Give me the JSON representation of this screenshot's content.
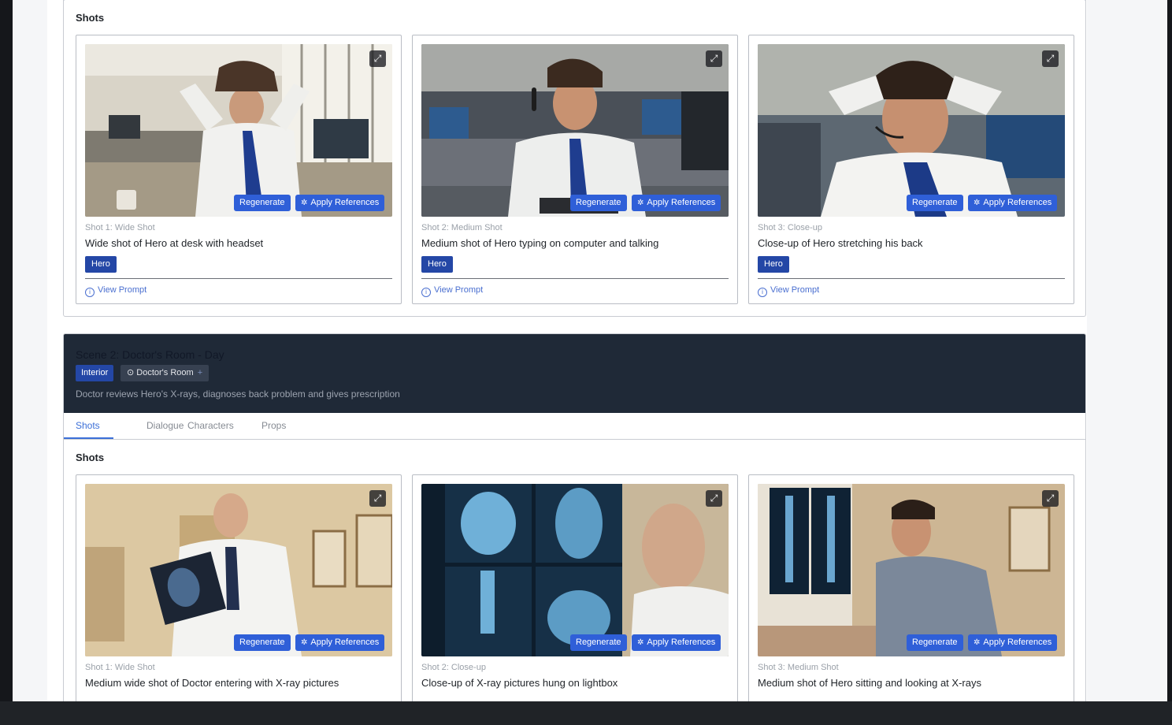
{
  "scene1": {
    "section_title": "Shots",
    "shots": [
      {
        "label": "Shot 1: Wide Shot",
        "description": "Wide shot of Hero at desk with headset",
        "character": "Hero",
        "regenerate": "Regenerate",
        "apply_references": "Apply References",
        "view_prompt": "View Prompt"
      },
      {
        "label": "Shot 2: Medium Shot",
        "description": "Medium shot of Hero typing on computer and talking",
        "character": "Hero",
        "regenerate": "Regenerate",
        "apply_references": "Apply References",
        "view_prompt": "View Prompt"
      },
      {
        "label": "Shot 3: Close-up",
        "description": "Close-up of Hero stretching his back",
        "character": "Hero",
        "regenerate": "Regenerate",
        "apply_references": "Apply References",
        "view_prompt": "View Prompt"
      }
    ]
  },
  "scene2": {
    "title": "Scene 2: Doctor's Room - Day",
    "setting_tag": "Interior",
    "location_tag": "Doctor's Room",
    "description": "Doctor reviews Hero's X-rays, diagnoses back problem and gives prescription",
    "tabs": [
      "Shots",
      "Dialogue",
      "Characters",
      "Props"
    ],
    "active_tab": "Shots",
    "section_title": "Shots",
    "shots": [
      {
        "label": "Shot 1: Wide Shot",
        "description": "Medium wide shot of Doctor entering with X-ray pictures",
        "regenerate": "Regenerate",
        "apply_references": "Apply References"
      },
      {
        "label": "Shot 2: Close-up",
        "description": "Close-up of X-ray pictures hung on lightbox",
        "regenerate": "Regenerate",
        "apply_references": "Apply References"
      },
      {
        "label": "Shot 3: Medium Shot",
        "description": "Medium shot of Hero sitting and looking at X-rays",
        "regenerate": "Regenerate",
        "apply_references": "Apply References"
      }
    ]
  },
  "icons": {
    "expand": "expand-icon",
    "sparkle": "sparkle-icon",
    "info": "info-icon",
    "location": "location-pin-icon",
    "plus": "plus-icon"
  },
  "colors": {
    "accent": "#2f5fd8",
    "tag": "#2447a6",
    "scene_header": "#1f2937",
    "link": "#4a6fd0"
  }
}
